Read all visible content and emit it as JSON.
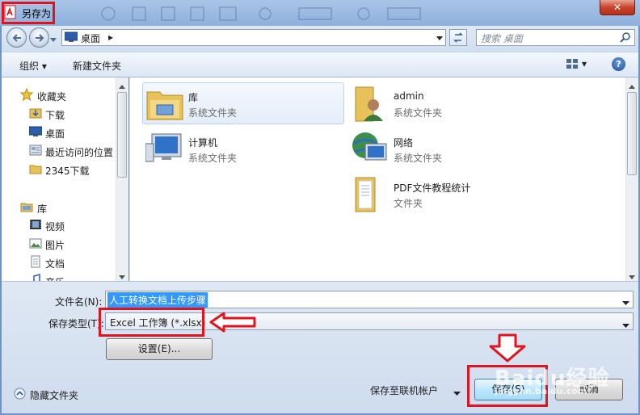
{
  "window": {
    "title": "另存为",
    "close_label": "✕"
  },
  "address": {
    "location": "桌面",
    "separator": "▸",
    "search_placeholder": "搜索 桌面"
  },
  "toolbar": {
    "organize": "组织 ▾",
    "new_folder": "新建文件夹",
    "view_arrow": "▾",
    "help": "?"
  },
  "nav": {
    "favorites": {
      "label": "收藏夹",
      "items": [
        "下载",
        "桌面",
        "最近访问的位置",
        "2345下载"
      ]
    },
    "libraries": {
      "label": "库",
      "items": [
        "视频",
        "图片",
        "文档",
        "音乐"
      ]
    }
  },
  "content": {
    "items": [
      {
        "name": "库",
        "type": "系统文件夹",
        "icon": "library-icon"
      },
      {
        "name": "admin",
        "type": "系统文件夹",
        "icon": "user-folder-icon"
      },
      {
        "name": "计算机",
        "type": "系统文件夹",
        "icon": "computer-icon"
      },
      {
        "name": "网络",
        "type": "系统文件夹",
        "icon": "network-icon"
      },
      {
        "name": "PDF文件教程统计",
        "type": "文件夹",
        "icon": "folder-icon"
      }
    ]
  },
  "form": {
    "filename_label": "文件名(N):",
    "filename_value": "人工转换文档上传步骤",
    "filetype_label": "保存类型(T):",
    "filetype_value": "Excel 工作簿 (*.xlsx)",
    "settings_button": "设置(E)...",
    "hide_folders": "隐藏文件夹",
    "save_online": "保存至联机帐户",
    "save_button": "保存(S)",
    "cancel_button": "取消"
  },
  "watermark": {
    "brand": "Baidu经验",
    "url": "jingyan.baidu.com"
  },
  "colors": {
    "highlight_red": "#e0141e",
    "selection_blue": "#3399ff"
  }
}
